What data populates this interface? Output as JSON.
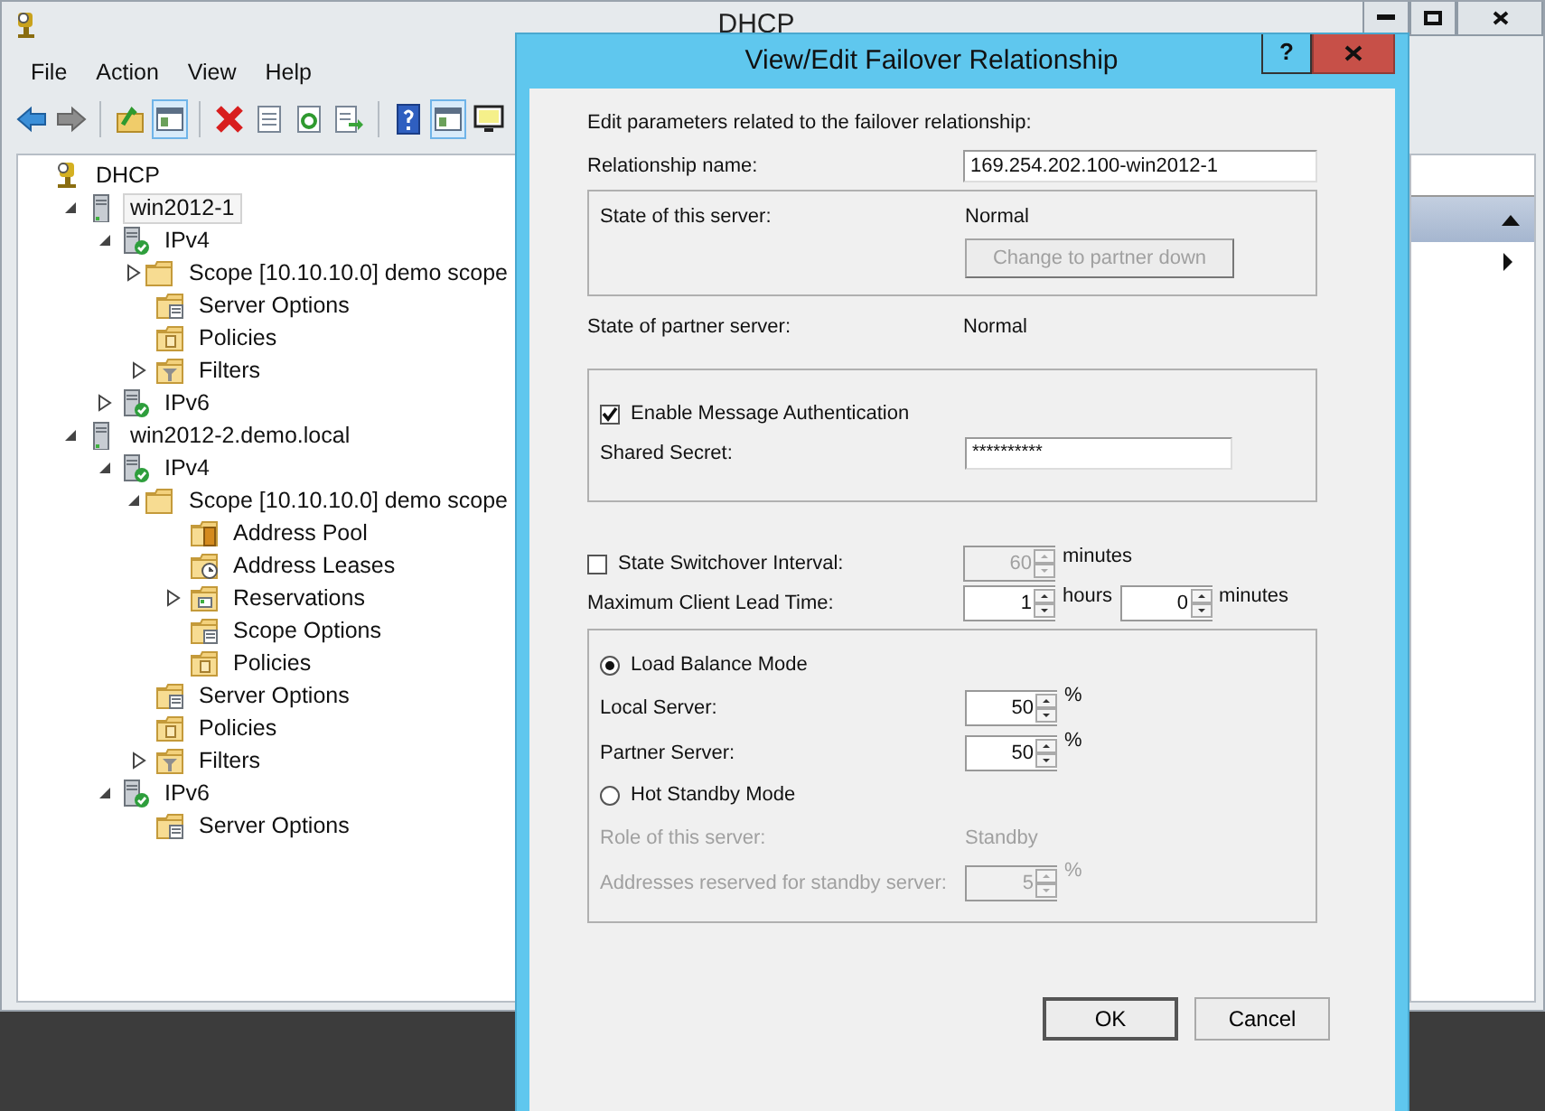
{
  "window": {
    "title": "DHCP"
  },
  "menu": [
    "File",
    "Action",
    "View",
    "Help"
  ],
  "toolbar": [
    {
      "kind": "back",
      "pressed": false
    },
    {
      "kind": "forward",
      "pressed": false
    },
    {
      "kind": "sep"
    },
    {
      "kind": "up",
      "pressed": false
    },
    {
      "kind": "pane",
      "pressed": true
    },
    {
      "kind": "sep"
    },
    {
      "kind": "delete",
      "pressed": false
    },
    {
      "kind": "properties",
      "pressed": false
    },
    {
      "kind": "refresh",
      "pressed": false
    },
    {
      "kind": "export",
      "pressed": false
    },
    {
      "kind": "sep"
    },
    {
      "kind": "help",
      "pressed": false
    },
    {
      "kind": "pane",
      "pressed": true
    },
    {
      "kind": "monitor",
      "pressed": false
    }
  ],
  "tree": [
    {
      "label": "DHCP",
      "kind": "root",
      "selected": false,
      "children": [
        {
          "label": "win2012-1",
          "kind": "server",
          "selected": true,
          "expanded": true,
          "children": [
            {
              "label": "IPv4",
              "kind": "protocol",
              "selected": false,
              "expanded": true,
              "children": [
                {
                  "label": "Scope [10.10.10.0] demo scope",
                  "kind": "folder",
                  "selected": false,
                  "expanded": false
                },
                {
                  "label": "Server Options",
                  "kind": "options",
                  "selected": false
                },
                {
                  "label": "Policies",
                  "kind": "policy",
                  "selected": false
                },
                {
                  "label": "Filters",
                  "kind": "filter",
                  "selected": false,
                  "expanded": false
                }
              ]
            },
            {
              "label": "IPv6",
              "kind": "protocol",
              "selected": false,
              "expanded": false
            }
          ]
        },
        {
          "label": "win2012-2.demo.local",
          "kind": "server",
          "selected": false,
          "expanded": true,
          "children": [
            {
              "label": "IPv4",
              "kind": "protocol",
              "selected": false,
              "expanded": true,
              "children": [
                {
                  "label": "Scope [10.10.10.0] demo scope",
                  "kind": "folder",
                  "selected": false,
                  "expanded": true,
                  "children": [
                    {
                      "label": "Address Pool",
                      "kind": "pool",
                      "selected": false
                    },
                    {
                      "label": "Address Leases",
                      "kind": "leases",
                      "selected": false
                    },
                    {
                      "label": "Reservations",
                      "kind": "reservations",
                      "selected": false,
                      "expanded": false
                    },
                    {
                      "label": "Scope Options",
                      "kind": "options",
                      "selected": false
                    },
                    {
                      "label": "Policies",
                      "kind": "policy",
                      "selected": false
                    }
                  ]
                },
                {
                  "label": "Server Options",
                  "kind": "options",
                  "selected": false
                },
                {
                  "label": "Policies",
                  "kind": "policy",
                  "selected": false
                },
                {
                  "label": "Filters",
                  "kind": "filter",
                  "selected": false,
                  "expanded": false
                }
              ]
            },
            {
              "label": "IPv6",
              "kind": "protocol",
              "selected": false,
              "expanded": true,
              "children": [
                {
                  "label": "Server Options",
                  "kind": "options",
                  "selected": false
                }
              ]
            }
          ]
        }
      ]
    }
  ],
  "dialog": {
    "title": "View/Edit Failover Relationship",
    "help": "?",
    "intro": "Edit parameters related to the failover relationship:",
    "relationship": {
      "label": "Relationship name:",
      "value": "169.254.202.100-win2012-1"
    },
    "this_server": {
      "label": "State of this server:",
      "value": "Normal",
      "button": {
        "label": "Change to partner down",
        "disabled": true
      }
    },
    "partner_server": {
      "label": "State of partner server:",
      "value": "Normal"
    },
    "auth": {
      "label": "Enable Message Authentication",
      "checked": true,
      "secret_label": "Shared Secret:",
      "secret_value": "**********"
    },
    "switchover": {
      "label": "State Switchover Interval:",
      "checked": false,
      "value": "60",
      "disabled": true,
      "unit": "minutes"
    },
    "lead_time": {
      "label": "Maximum Client Lead Time:",
      "hours": "1",
      "hours_unit": "hours",
      "minutes": "0",
      "minutes_unit": "minutes"
    },
    "modes": [
      {
        "label": "Load Balance Mode",
        "selected": true,
        "rows": [
          {
            "kind": "spin",
            "label": "Local Server:",
            "value": "50",
            "unit": "%",
            "disabled": false
          },
          {
            "kind": "spin",
            "label": "Partner Server:",
            "value": "50",
            "unit": "%",
            "disabled": false
          }
        ]
      },
      {
        "label": "Hot Standby Mode",
        "selected": false,
        "rows": [
          {
            "kind": "text",
            "label": "Role of this server:",
            "value": "Standby",
            "disabled": true
          },
          {
            "kind": "spin",
            "label": "Addresses reserved for standby server:",
            "value": "5",
            "unit": "%",
            "disabled": true
          }
        ]
      }
    ],
    "buttons": [
      {
        "label": "OK",
        "default": true
      },
      {
        "label": "Cancel",
        "default": false
      }
    ]
  }
}
